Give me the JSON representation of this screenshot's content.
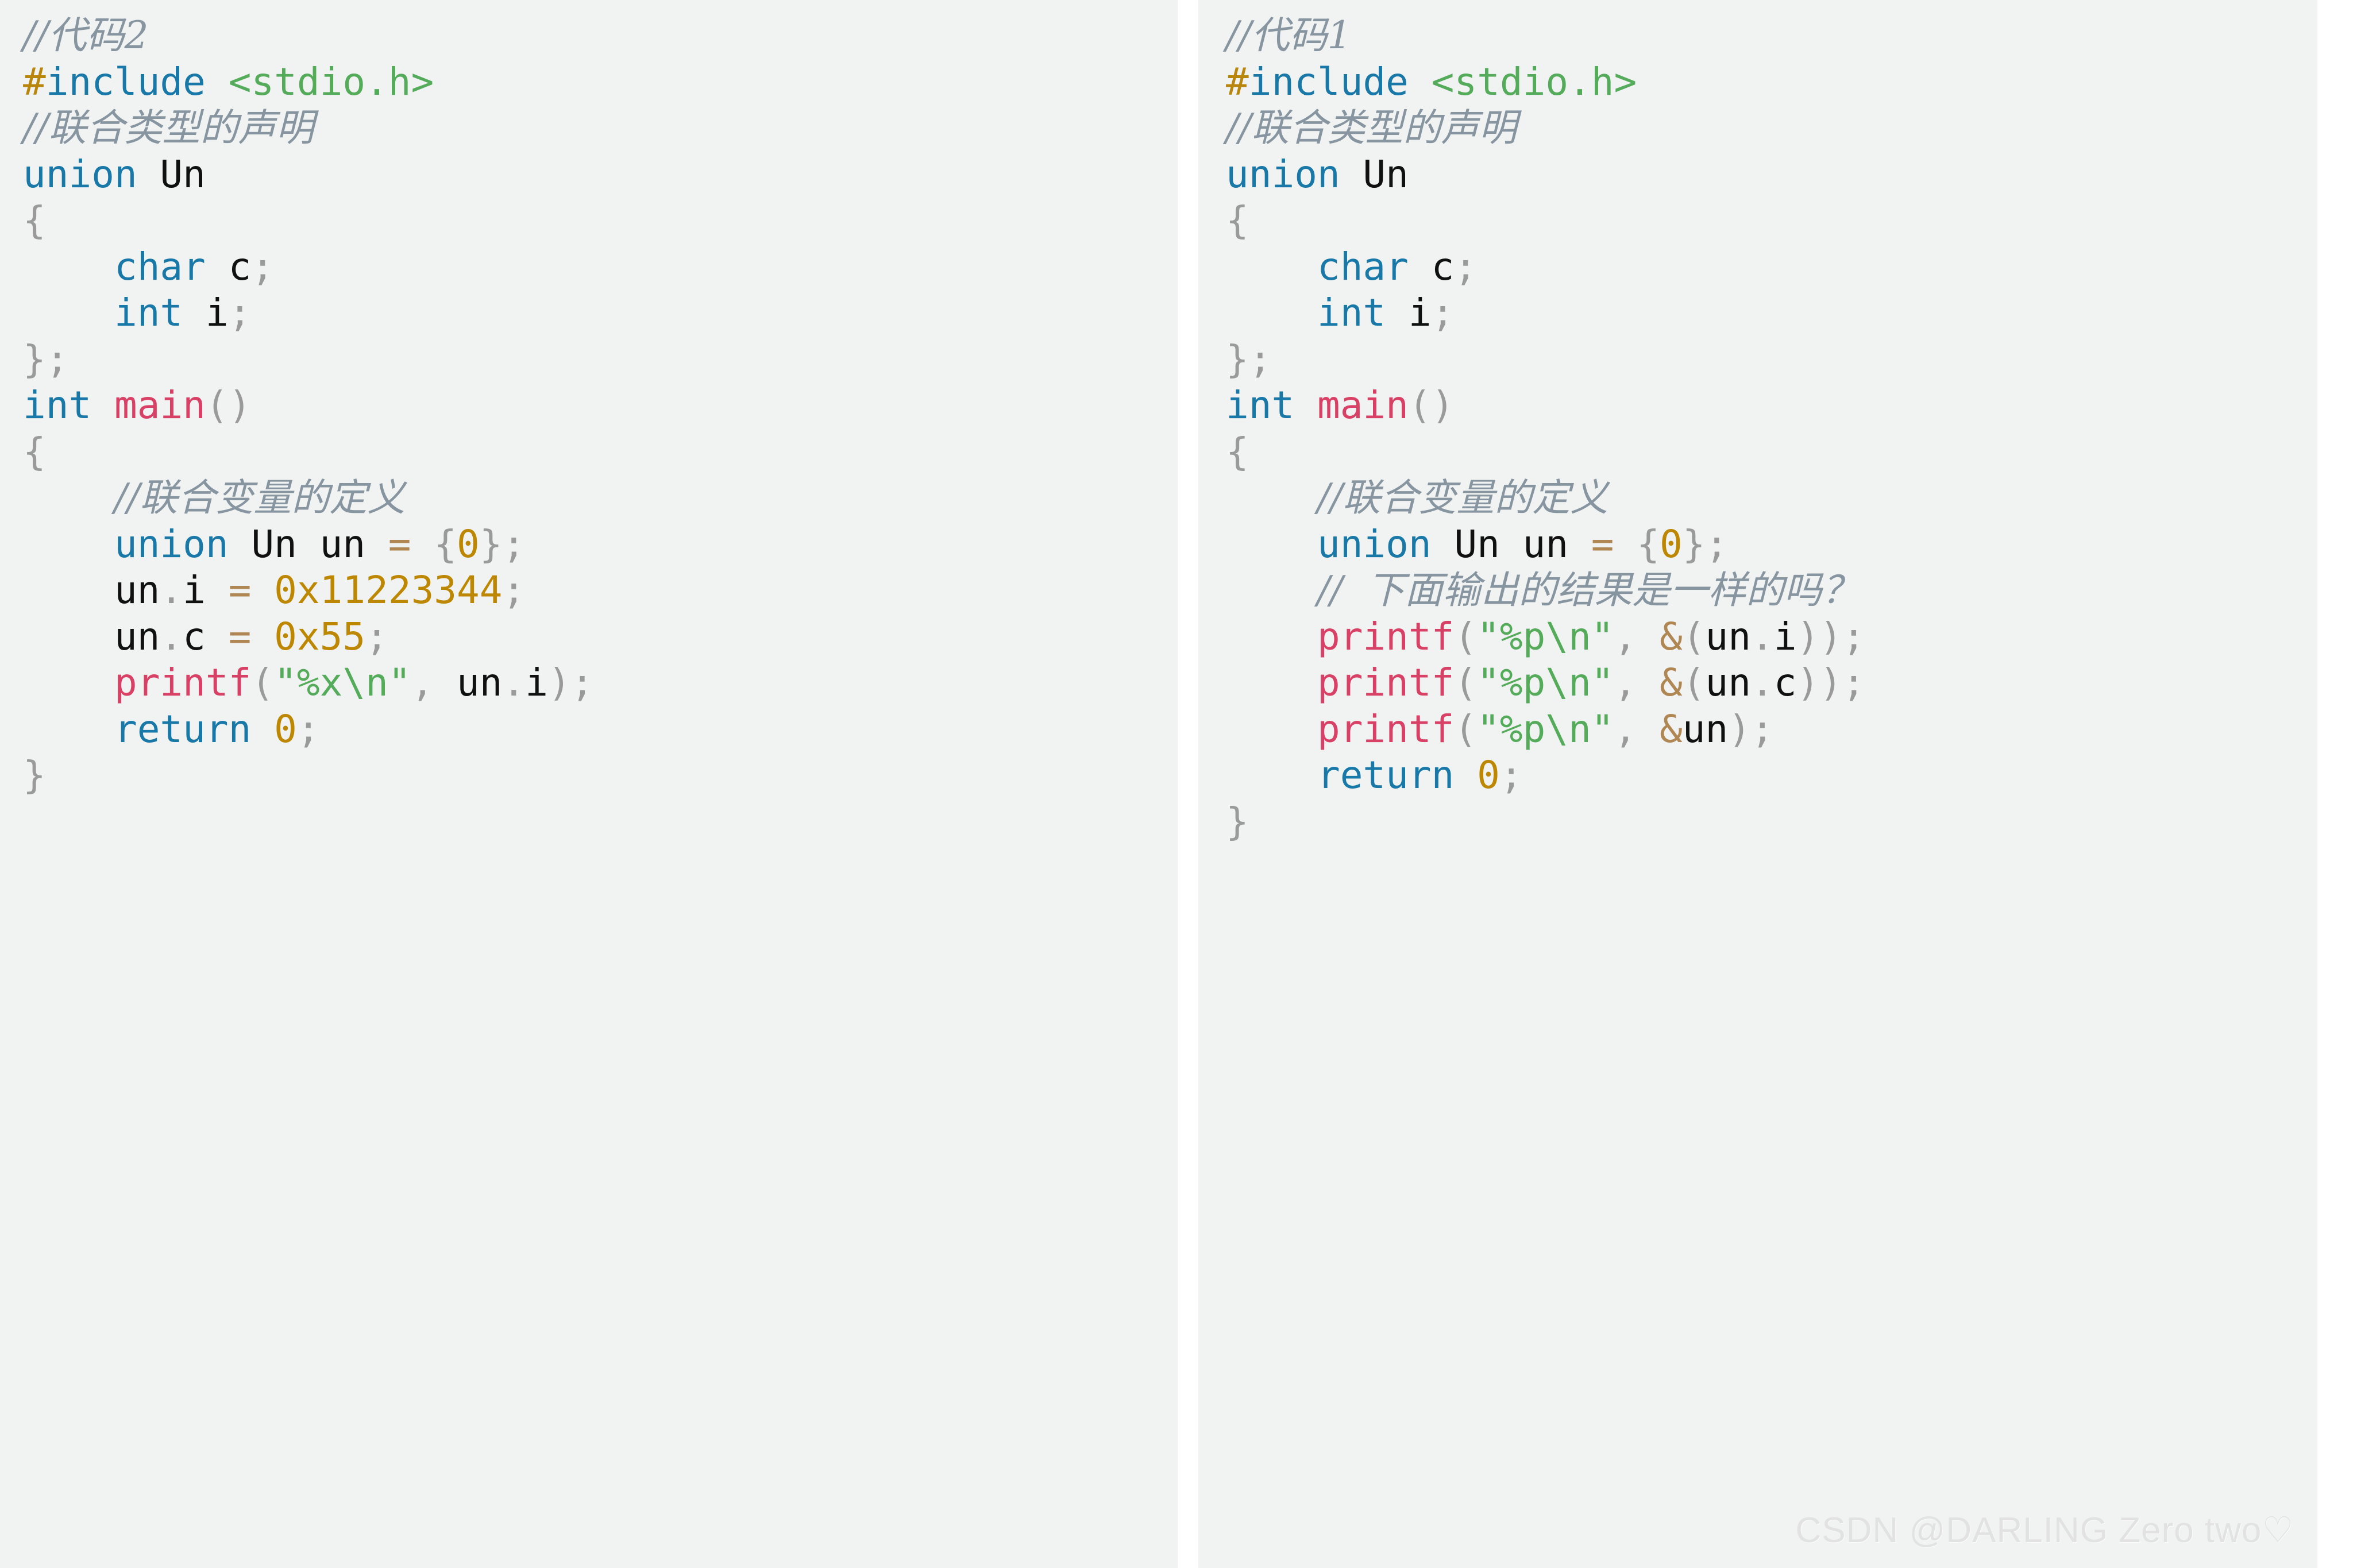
{
  "meta": {
    "background": "#ffffff",
    "panel_background": "#f1f2f2",
    "colors": {
      "comment": "#8795a1",
      "keyword": "#1878a8",
      "preprocessor": "#b8860b",
      "string": "#54ab5a",
      "function": "#d94065",
      "number": "#bd8800",
      "operator": "#b08752",
      "punctuation": "#9a9a9a",
      "identifier": "#101010"
    }
  },
  "left_panel": {
    "title_comment": "//代码2",
    "language": "c",
    "lines": [
      {
        "id": "l0",
        "tokens": [
          {
            "t": "cmt",
            "v": "//代码2"
          }
        ]
      },
      {
        "id": "l1",
        "tokens": [
          {
            "t": "pre",
            "v": "#"
          },
          {
            "t": "kw",
            "v": "include"
          },
          {
            "t": "id",
            "v": " "
          },
          {
            "t": "str",
            "v": "<stdio.h>"
          }
        ]
      },
      {
        "id": "l2",
        "tokens": [
          {
            "t": "cmt",
            "v": "//联合类型的声明"
          }
        ]
      },
      {
        "id": "l3",
        "tokens": [
          {
            "t": "kw",
            "v": "union"
          },
          {
            "t": "id",
            "v": " Un"
          }
        ]
      },
      {
        "id": "l4",
        "tokens": [
          {
            "t": "pun",
            "v": "{"
          }
        ]
      },
      {
        "id": "l5",
        "tokens": [
          {
            "t": "id",
            "v": "    "
          },
          {
            "t": "kw",
            "v": "char"
          },
          {
            "t": "id",
            "v": " c"
          },
          {
            "t": "pun",
            "v": ";"
          }
        ]
      },
      {
        "id": "l6",
        "tokens": [
          {
            "t": "id",
            "v": "    "
          },
          {
            "t": "kw",
            "v": "int"
          },
          {
            "t": "id",
            "v": " i"
          },
          {
            "t": "pun",
            "v": ";"
          }
        ]
      },
      {
        "id": "l7",
        "tokens": [
          {
            "t": "pun",
            "v": "};"
          }
        ]
      },
      {
        "id": "l8",
        "tokens": [
          {
            "t": "kw",
            "v": "int"
          },
          {
            "t": "id",
            "v": " "
          },
          {
            "t": "fn",
            "v": "main"
          },
          {
            "t": "pun",
            "v": "()"
          }
        ]
      },
      {
        "id": "l9",
        "tokens": [
          {
            "t": "pun",
            "v": "{"
          }
        ]
      },
      {
        "id": "l10",
        "tokens": [
          {
            "t": "id",
            "v": "    "
          },
          {
            "t": "cmt",
            "v": "//联合变量的定义"
          }
        ]
      },
      {
        "id": "l11",
        "tokens": [
          {
            "t": "id",
            "v": "    "
          },
          {
            "t": "kw",
            "v": "union"
          },
          {
            "t": "id",
            "v": " Un un "
          },
          {
            "t": "op",
            "v": "="
          },
          {
            "t": "id",
            "v": " "
          },
          {
            "t": "pun",
            "v": "{"
          },
          {
            "t": "num",
            "v": "0"
          },
          {
            "t": "pun",
            "v": "};"
          }
        ]
      },
      {
        "id": "l12",
        "tokens": [
          {
            "t": "id",
            "v": "    un"
          },
          {
            "t": "pun",
            "v": "."
          },
          {
            "t": "id",
            "v": "i "
          },
          {
            "t": "op",
            "v": "="
          },
          {
            "t": "id",
            "v": " "
          },
          {
            "t": "num",
            "v": "0x11223344"
          },
          {
            "t": "pun",
            "v": ";"
          }
        ]
      },
      {
        "id": "l13",
        "tokens": [
          {
            "t": "id",
            "v": "    un"
          },
          {
            "t": "pun",
            "v": "."
          },
          {
            "t": "id",
            "v": "c "
          },
          {
            "t": "op",
            "v": "="
          },
          {
            "t": "id",
            "v": " "
          },
          {
            "t": "num",
            "v": "0x55"
          },
          {
            "t": "pun",
            "v": ";"
          }
        ]
      },
      {
        "id": "l14",
        "tokens": [
          {
            "t": "id",
            "v": "    "
          },
          {
            "t": "fn",
            "v": "printf"
          },
          {
            "t": "pun",
            "v": "("
          },
          {
            "t": "str",
            "v": "\"%x\\n\""
          },
          {
            "t": "pun",
            "v": ","
          },
          {
            "t": "id",
            "v": " un"
          },
          {
            "t": "pun",
            "v": "."
          },
          {
            "t": "id",
            "v": "i"
          },
          {
            "t": "pun",
            "v": ");"
          }
        ]
      },
      {
        "id": "l15",
        "tokens": [
          {
            "t": "id",
            "v": "    "
          },
          {
            "t": "kw",
            "v": "return"
          },
          {
            "t": "id",
            "v": " "
          },
          {
            "t": "num",
            "v": "0"
          },
          {
            "t": "pun",
            "v": ";"
          }
        ]
      },
      {
        "id": "l16",
        "tokens": [
          {
            "t": "pun",
            "v": "}"
          }
        ]
      }
    ]
  },
  "right_panel": {
    "title_comment": "//代码1",
    "language": "c",
    "lines": [
      {
        "id": "r0",
        "tokens": [
          {
            "t": "cmt",
            "v": "//代码1"
          }
        ]
      },
      {
        "id": "r1",
        "tokens": [
          {
            "t": "pre",
            "v": "#"
          },
          {
            "t": "kw",
            "v": "include"
          },
          {
            "t": "id",
            "v": " "
          },
          {
            "t": "str",
            "v": "<stdio.h>"
          }
        ]
      },
      {
        "id": "r2",
        "tokens": [
          {
            "t": "cmt",
            "v": "//联合类型的声明"
          }
        ]
      },
      {
        "id": "r3",
        "tokens": [
          {
            "t": "kw",
            "v": "union"
          },
          {
            "t": "id",
            "v": " Un"
          }
        ]
      },
      {
        "id": "r4",
        "tokens": [
          {
            "t": "pun",
            "v": "{"
          }
        ]
      },
      {
        "id": "r5",
        "tokens": [
          {
            "t": "id",
            "v": "    "
          },
          {
            "t": "kw",
            "v": "char"
          },
          {
            "t": "id",
            "v": " c"
          },
          {
            "t": "pun",
            "v": ";"
          }
        ]
      },
      {
        "id": "r6",
        "tokens": [
          {
            "t": "id",
            "v": "    "
          },
          {
            "t": "kw",
            "v": "int"
          },
          {
            "t": "id",
            "v": " i"
          },
          {
            "t": "pun",
            "v": ";"
          }
        ]
      },
      {
        "id": "r7",
        "tokens": [
          {
            "t": "pun",
            "v": "};"
          }
        ]
      },
      {
        "id": "r8",
        "tokens": [
          {
            "t": "kw",
            "v": "int"
          },
          {
            "t": "id",
            "v": " "
          },
          {
            "t": "fn",
            "v": "main"
          },
          {
            "t": "pun",
            "v": "()"
          }
        ]
      },
      {
        "id": "r9",
        "tokens": [
          {
            "t": "pun",
            "v": "{"
          }
        ]
      },
      {
        "id": "r10",
        "tokens": [
          {
            "t": "id",
            "v": "    "
          },
          {
            "t": "cmt",
            "v": "//联合变量的定义"
          }
        ]
      },
      {
        "id": "r11",
        "tokens": [
          {
            "t": "id",
            "v": "    "
          },
          {
            "t": "kw",
            "v": "union"
          },
          {
            "t": "id",
            "v": " Un un "
          },
          {
            "t": "op",
            "v": "="
          },
          {
            "t": "id",
            "v": " "
          },
          {
            "t": "pun",
            "v": "{"
          },
          {
            "t": "num",
            "v": "0"
          },
          {
            "t": "pun",
            "v": "};"
          }
        ]
      },
      {
        "id": "r12",
        "tokens": [
          {
            "t": "id",
            "v": "    "
          },
          {
            "t": "cmt",
            "v": "//  下面输出的结果是一样的吗？"
          }
        ]
      },
      {
        "id": "r13",
        "tokens": [
          {
            "t": "id",
            "v": "    "
          },
          {
            "t": "fn",
            "v": "printf"
          },
          {
            "t": "pun",
            "v": "("
          },
          {
            "t": "str",
            "v": "\"%p\\n\""
          },
          {
            "t": "pun",
            "v": ","
          },
          {
            "t": "id",
            "v": " "
          },
          {
            "t": "op",
            "v": "&"
          },
          {
            "t": "pun",
            "v": "("
          },
          {
            "t": "id",
            "v": "un"
          },
          {
            "t": "pun",
            "v": "."
          },
          {
            "t": "id",
            "v": "i"
          },
          {
            "t": "pun",
            "v": "));"
          }
        ]
      },
      {
        "id": "r14",
        "tokens": [
          {
            "t": "id",
            "v": "    "
          },
          {
            "t": "fn",
            "v": "printf"
          },
          {
            "t": "pun",
            "v": "("
          },
          {
            "t": "str",
            "v": "\"%p\\n\""
          },
          {
            "t": "pun",
            "v": ","
          },
          {
            "t": "id",
            "v": " "
          },
          {
            "t": "op",
            "v": "&"
          },
          {
            "t": "pun",
            "v": "("
          },
          {
            "t": "id",
            "v": "un"
          },
          {
            "t": "pun",
            "v": "."
          },
          {
            "t": "id",
            "v": "c"
          },
          {
            "t": "pun",
            "v": "));"
          }
        ]
      },
      {
        "id": "r15",
        "tokens": [
          {
            "t": "id",
            "v": "    "
          },
          {
            "t": "fn",
            "v": "printf"
          },
          {
            "t": "pun",
            "v": "("
          },
          {
            "t": "str",
            "v": "\"%p\\n\""
          },
          {
            "t": "pun",
            "v": ","
          },
          {
            "t": "id",
            "v": " "
          },
          {
            "t": "op",
            "v": "&"
          },
          {
            "t": "id",
            "v": "un"
          },
          {
            "t": "pun",
            "v": ");"
          }
        ]
      },
      {
        "id": "r16",
        "tokens": [
          {
            "t": "id",
            "v": "    "
          },
          {
            "t": "kw",
            "v": "return"
          },
          {
            "t": "id",
            "v": " "
          },
          {
            "t": "num",
            "v": "0"
          },
          {
            "t": "pun",
            "v": ";"
          }
        ]
      },
      {
        "id": "r17",
        "tokens": [
          {
            "t": "pun",
            "v": "}"
          }
        ]
      }
    ]
  },
  "watermark": {
    "text": "CSDN @DARLING Zero two♡"
  }
}
